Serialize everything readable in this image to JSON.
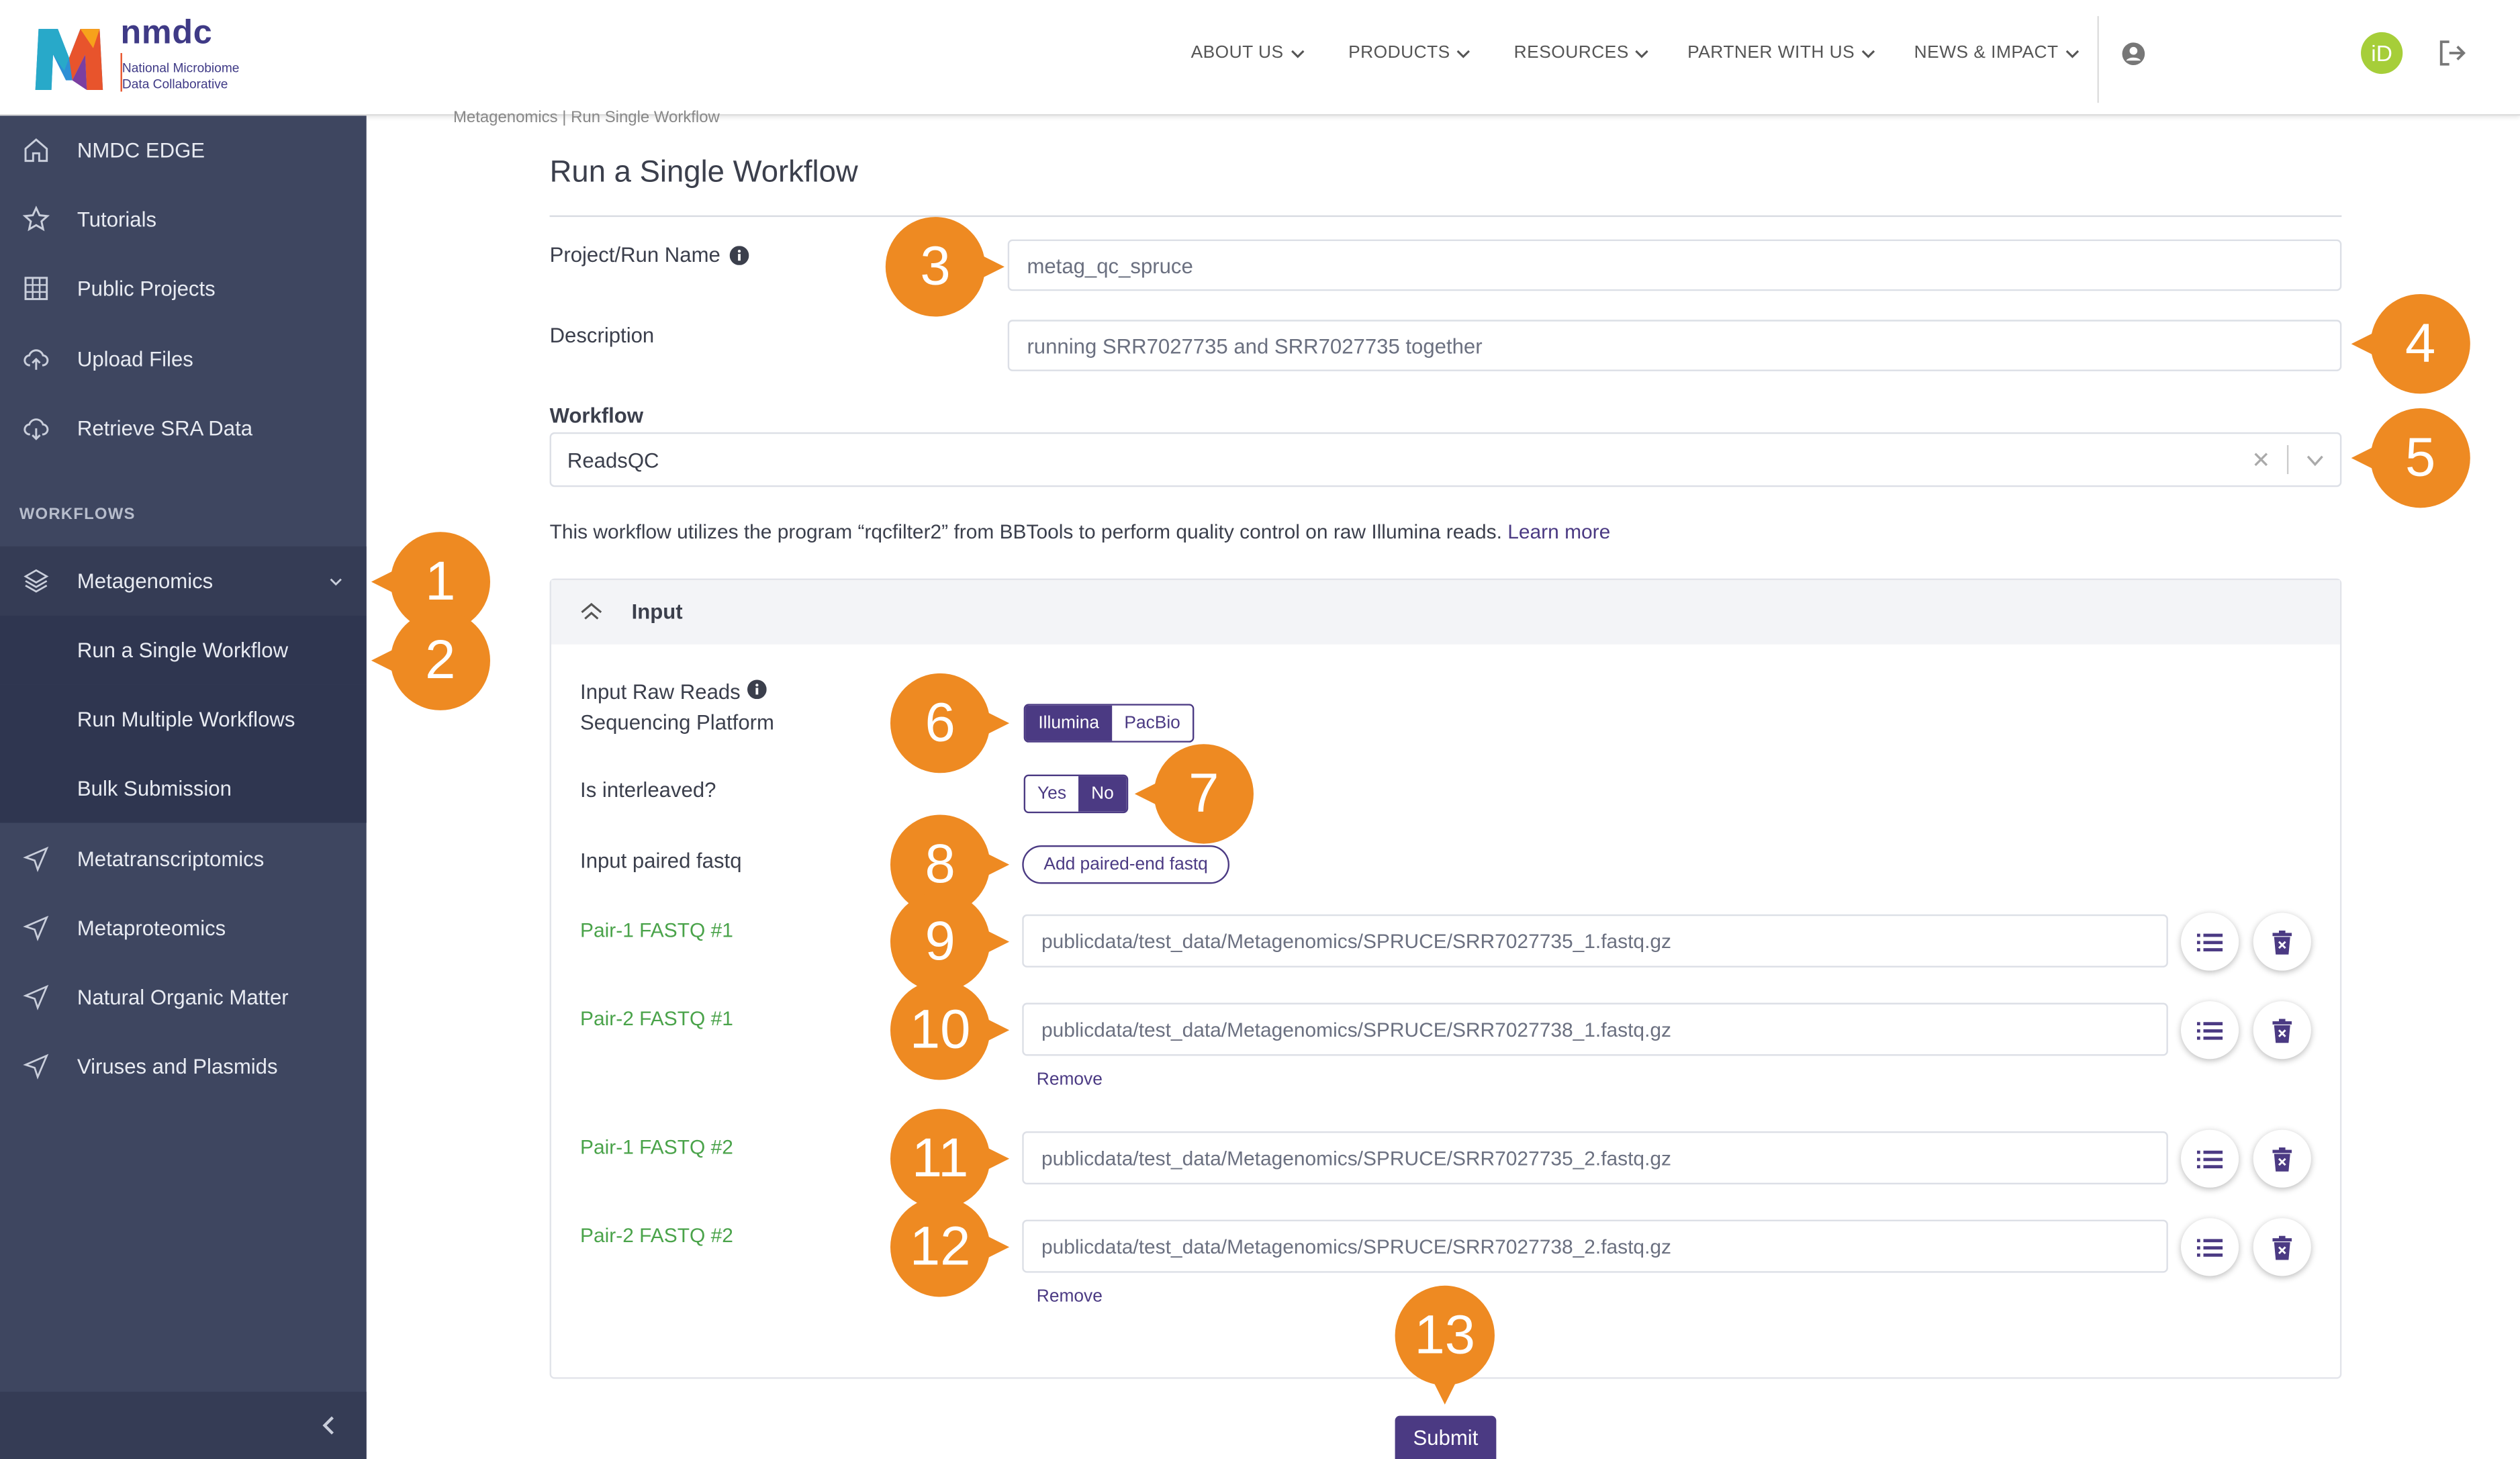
{
  "brand": {
    "name": "nmdc",
    "subtitle_line1": "National Microbiome",
    "subtitle_line2": "Data Collaborative"
  },
  "nav": [
    "ABOUT US",
    "PRODUCTS",
    "RESOURCES",
    "PARTNER WITH US",
    "NEWS & IMPACT"
  ],
  "header_icons": [
    "user-circle-icon",
    "orcid-icon",
    "logout-icon"
  ],
  "sidebar": {
    "items": [
      {
        "label": "NMDC EDGE",
        "icon": "home-icon"
      },
      {
        "label": "Tutorials",
        "icon": "star-icon"
      },
      {
        "label": "Public Projects",
        "icon": "grid-icon"
      },
      {
        "label": "Upload Files",
        "icon": "cloud-upload-icon"
      },
      {
        "label": "Retrieve SRA Data",
        "icon": "cloud-download-icon"
      }
    ],
    "section_label": "WORKFLOWS",
    "workflows": [
      {
        "label": "Metagenomics",
        "icon": "layers-icon"
      },
      {
        "label": "Metatranscriptomics",
        "icon": "send-icon"
      },
      {
        "label": "Metaproteomics",
        "icon": "send-icon"
      },
      {
        "label": "Natural Organic Matter",
        "icon": "send-icon"
      },
      {
        "label": "Viruses and Plasmids",
        "icon": "send-icon"
      }
    ],
    "sub_items": [
      "Run a Single Workflow",
      "Run Multiple Workflows",
      "Bulk Submission"
    ]
  },
  "breadcrumb": "Metagenomics | Run Single Workflow",
  "page_title": "Run a Single Workflow",
  "form": {
    "project_label": "Project/Run Name",
    "project_value": "metag_qc_spruce",
    "description_label": "Description",
    "description_value": "running SRR7027735 and SRR7027735 together",
    "workflow_label": "Workflow",
    "workflow_value": "ReadsQC",
    "workflow_info": "This workflow utilizes the program “rqcfilter2” from BBTools to perform quality control on raw Illumina reads.",
    "learn_more": "Learn more"
  },
  "input_section": {
    "title": "Input",
    "platform_label_line1": "Input Raw Reads",
    "platform_label_line2": "Sequencing Platform",
    "platform_options": [
      "Illumina",
      "PacBio"
    ],
    "platform_selected": "Illumina",
    "interleaved_label": "Is interleaved?",
    "interleaved_options": [
      "Yes",
      "No"
    ],
    "interleaved_selected": "No",
    "paired_label": "Input paired fastq",
    "add_button": "Add paired-end fastq",
    "pairs": [
      {
        "label": "Pair-1 FASTQ #1",
        "value": "publicdata/test_data/Metagenomics/SPRUCE/SRR7027735_1.fastq.gz"
      },
      {
        "label": "Pair-2 FASTQ #1",
        "value": "publicdata/test_data/Metagenomics/SPRUCE/SRR7027738_1.fastq.gz"
      },
      {
        "label": "Pair-1 FASTQ #2",
        "value": "publicdata/test_data/Metagenomics/SPRUCE/SRR7027735_2.fastq.gz"
      },
      {
        "label": "Pair-2 FASTQ #2",
        "value": "publicdata/test_data/Metagenomics/SPRUCE/SRR7027738_2.fastq.gz"
      }
    ],
    "remove_label": "Remove"
  },
  "submit": "Submit",
  "callouts": [
    "1",
    "2",
    "3",
    "4",
    "5",
    "6",
    "7",
    "8",
    "9",
    "10",
    "11",
    "12",
    "13"
  ],
  "colors": {
    "sidebar": "#3e4660",
    "sidebar_sub": "#2f3650",
    "accent": "#4b3a83",
    "callout": "#ee8a22",
    "green_label": "#4aa34a"
  }
}
